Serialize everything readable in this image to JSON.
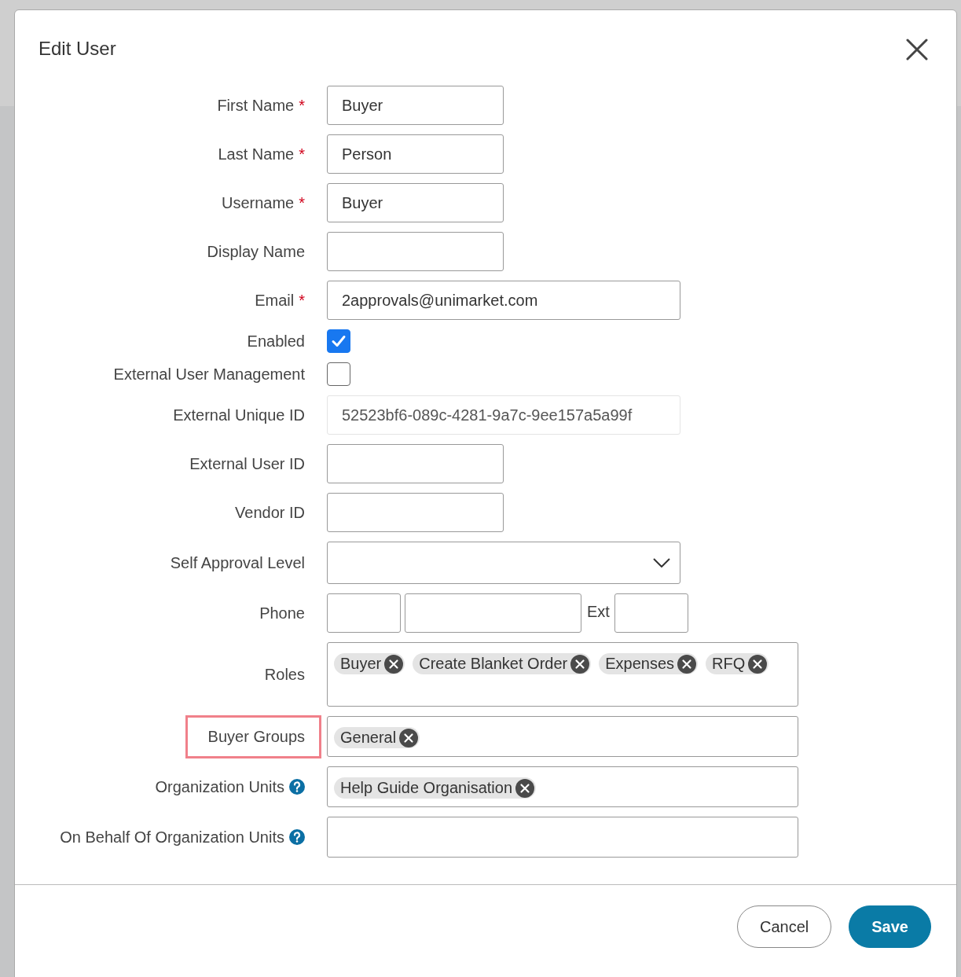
{
  "dialog": {
    "title": "Edit User"
  },
  "fields": [
    {
      "label": "First Name",
      "required_mark": "*",
      "kind": "text",
      "value": "Buyer"
    },
    {
      "label": "Last Name",
      "required_mark": "*",
      "kind": "text",
      "value": "Person"
    },
    {
      "label": "Username",
      "required_mark": "*",
      "kind": "text",
      "value": "Buyer"
    },
    {
      "label": "Display Name",
      "kind": "text"
    },
    {
      "label": "Email",
      "required_mark": "*",
      "kind": "widetext",
      "value": "2approvals@unimarket.com"
    },
    {
      "label": "Enabled",
      "kind": "checkbox",
      "checked": true
    },
    {
      "label": "External User Management",
      "kind": "checkbox",
      "checked": false
    },
    {
      "label": "External Unique ID",
      "kind": "widetext",
      "readonly": true,
      "value": "52523bf6-089c-4281-9a7c-9ee157a5a99f"
    },
    {
      "label": "External User ID",
      "kind": "text"
    },
    {
      "label": "Vendor ID",
      "kind": "text"
    },
    {
      "label": "Self Approval Level",
      "kind": "select"
    },
    {
      "label": "Phone",
      "kind": "phone",
      "ext_label": "Ext"
    },
    {
      "label": "Roles",
      "kind": "tags",
      "tall": true,
      "tags": [
        "Buyer",
        "Create Blanket Order",
        "Expenses",
        "RFQ"
      ]
    },
    {
      "label": "Buyer Groups",
      "kind": "tags",
      "highlighted": true,
      "tags": [
        "General"
      ]
    },
    {
      "label": "Organization Units",
      "kind": "tags",
      "help": true,
      "tags": [
        "Help Guide Organisation"
      ]
    },
    {
      "label": "On Behalf Of Organization Units",
      "kind": "tags",
      "help": true
    }
  ],
  "buttons": [
    {
      "label": "Cancel",
      "kind": "secondary"
    },
    {
      "label": "Save",
      "kind": "primary"
    }
  ]
}
